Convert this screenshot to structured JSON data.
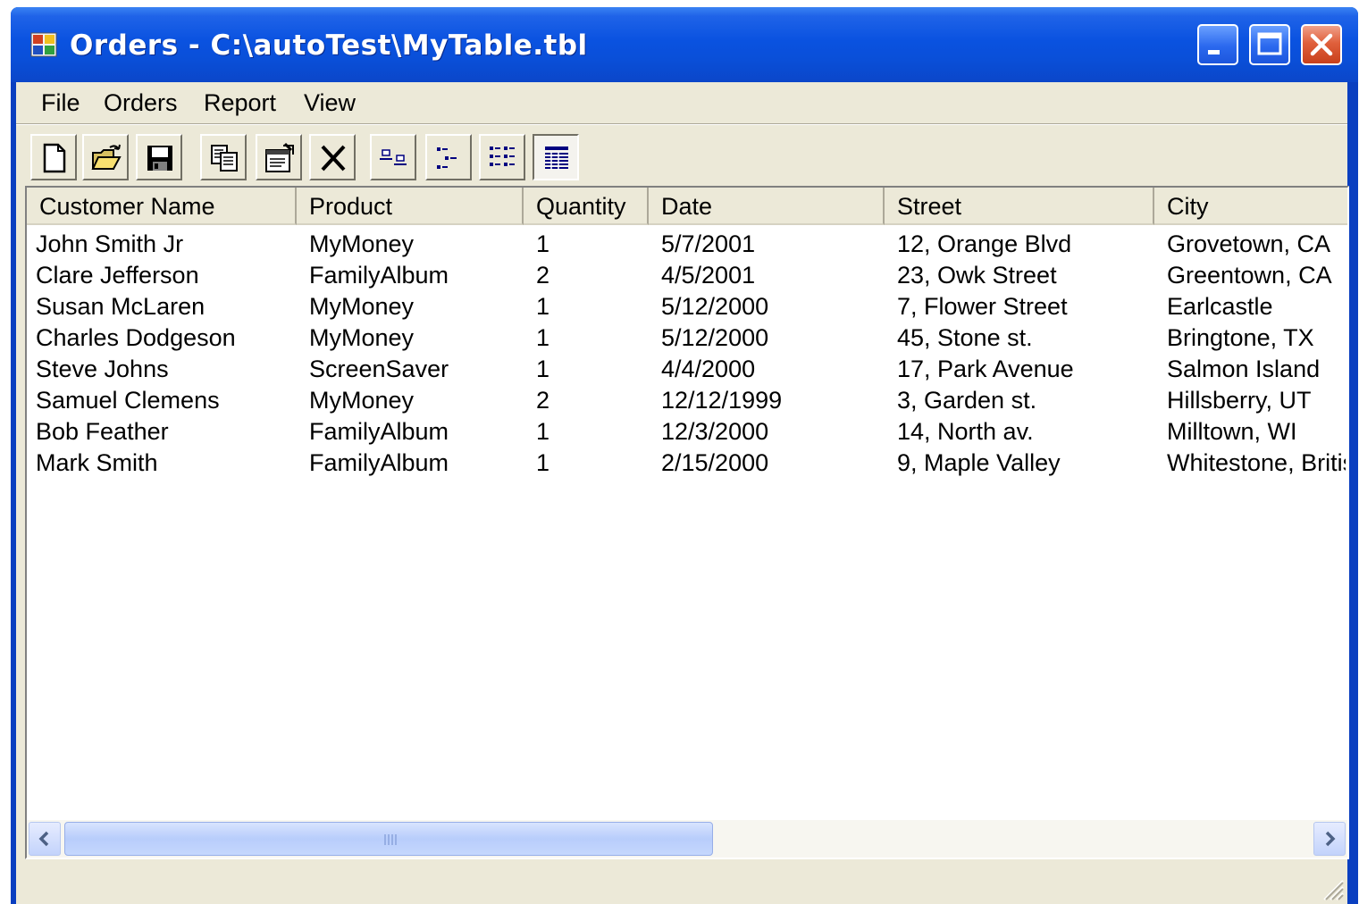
{
  "window": {
    "title": "Orders - C:\\autoTest\\MyTable.tbl"
  },
  "menu": [
    "File",
    "Orders",
    "Report",
    "View"
  ],
  "toolbar": {
    "buttons": [
      {
        "icon": "new-document-icon"
      },
      {
        "icon": "open-folder-icon"
      },
      {
        "icon": "save-disk-icon"
      },
      {
        "icon": "copy-icon"
      },
      {
        "icon": "properties-icon"
      },
      {
        "icon": "delete-x-icon"
      },
      {
        "icon": "view-large-icons-icon"
      },
      {
        "icon": "view-small-icons-icon"
      },
      {
        "icon": "view-list-icon"
      },
      {
        "icon": "view-details-icon"
      }
    ],
    "pressed": "view-details-icon"
  },
  "table": {
    "columns": [
      "Customer Name",
      "Product",
      "Quantity",
      "Date",
      "Street",
      "City"
    ],
    "rows": [
      [
        "John Smith Jr",
        "MyMoney",
        "1",
        "5/7/2001",
        "12, Orange Blvd",
        "Grovetown, CA"
      ],
      [
        "Clare Jefferson",
        "FamilyAlbum",
        "2",
        "4/5/2001",
        "23, Owk Street",
        "Greentown, CA"
      ],
      [
        "Susan McLaren",
        "MyMoney",
        "1",
        "5/12/2000",
        "7, Flower Street",
        "Earlcastle"
      ],
      [
        "Charles Dodgeson",
        "MyMoney",
        "1",
        "5/12/2000",
        "45, Stone st.",
        "Bringtone, TX"
      ],
      [
        "Steve Johns",
        "ScreenSaver",
        "1",
        "4/4/2000",
        "17, Park Avenue",
        "Salmon Island"
      ],
      [
        "Samuel Clemens",
        "MyMoney",
        "2",
        "12/12/1999",
        "3, Garden st.",
        "Hillsberry, UT"
      ],
      [
        "Bob Feather",
        "FamilyAlbum",
        "1",
        "12/3/2000",
        "14, North av.",
        "Milltown, WI"
      ],
      [
        "Mark Smith",
        "FamilyAlbum",
        "1",
        "2/15/2000",
        "9, Maple Valley",
        "Whitestone, Britis"
      ]
    ]
  },
  "colors": {
    "titlebar": "#0a52e0",
    "face": "#ece9d8",
    "close_button": "#e0603c"
  }
}
